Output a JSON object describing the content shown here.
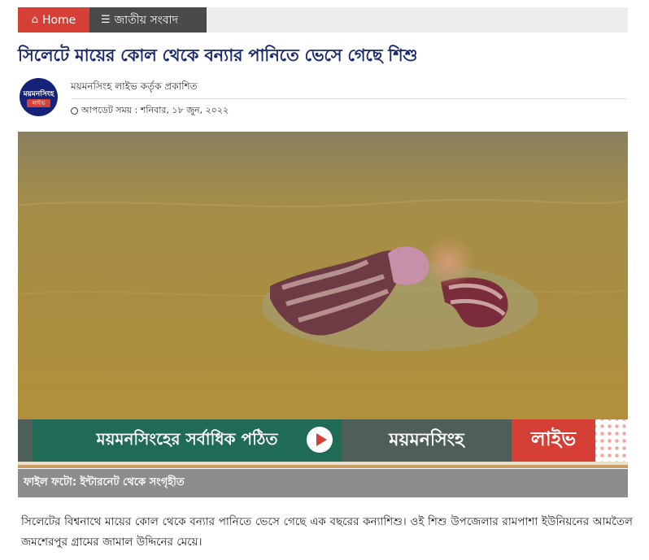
{
  "breadcrumb": {
    "home_label": "Home",
    "home_icon": "home-icon",
    "category_label": "জাতীয় সংবাদ",
    "category_icon": "menu-icon"
  },
  "article": {
    "title": "সিলেটে মায়ের কোল থেকে বন্যার পানিতে ভেসে গেছে শিশু",
    "author_line": "ময়মনসিংহ লাইভ কর্তৃক প্রকাশিত",
    "updated_line": "আপডেট সময় : শনিবার, ১৮ জুন, ২০২২",
    "photo_caption": "ফাইল ফটো: ইন্টারনেট থেকে সংগৃহীত",
    "body": "সিলেটের বিশ্বনাথে মায়ের কোল থেকে বন্যার পানিতে ভেসে গেছে এক বছরের কন্যাশিশু। ওই শিশু উপজেলার রামপাশা ইউনিয়নের আমতৈল জমশেরপুর গ্রামের জামাল উদ্দিনের মেয়ে।"
  },
  "logo": {
    "name_text": "ময়মনসিংহ",
    "live_text": "লাইভ"
  },
  "banner": {
    "left_text": "ময়মনসিংহের সর্বাধিক পঠিত",
    "mid_text": "ময়মনসিংহ",
    "right_text": "লাইভ"
  },
  "colors": {
    "accent_red": "#d63f35",
    "title_blue": "#1a2a6e",
    "dark_gray": "#4a4a4a",
    "caption_gray": "#8d8d8d"
  }
}
